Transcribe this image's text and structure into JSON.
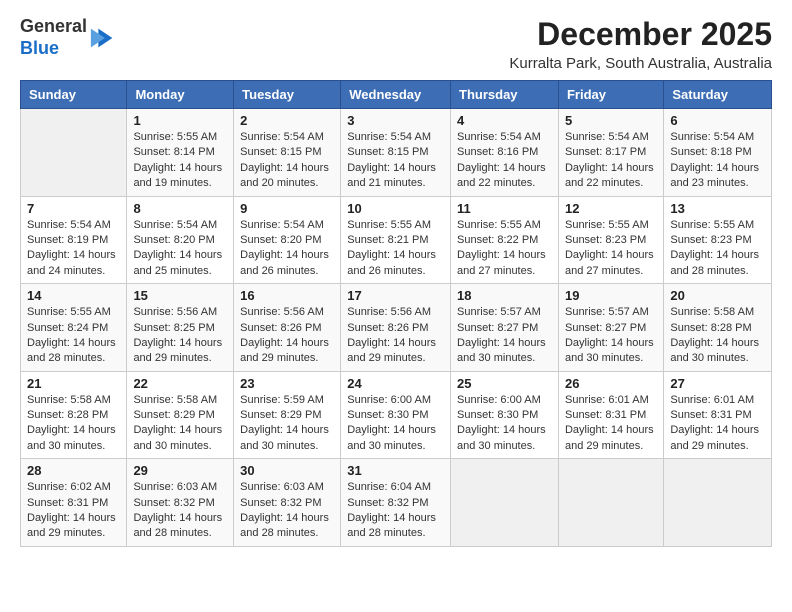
{
  "logo": {
    "general": "General",
    "blue": "Blue"
  },
  "title": {
    "month_year": "December 2025",
    "location": "Kurralta Park, South Australia, Australia"
  },
  "days_of_week": [
    "Sunday",
    "Monday",
    "Tuesday",
    "Wednesday",
    "Thursday",
    "Friday",
    "Saturday"
  ],
  "weeks": [
    [
      {
        "day": "",
        "info": ""
      },
      {
        "day": "1",
        "info": "Sunrise: 5:55 AM\nSunset: 8:14 PM\nDaylight: 14 hours\nand 19 minutes."
      },
      {
        "day": "2",
        "info": "Sunrise: 5:54 AM\nSunset: 8:15 PM\nDaylight: 14 hours\nand 20 minutes."
      },
      {
        "day": "3",
        "info": "Sunrise: 5:54 AM\nSunset: 8:15 PM\nDaylight: 14 hours\nand 21 minutes."
      },
      {
        "day": "4",
        "info": "Sunrise: 5:54 AM\nSunset: 8:16 PM\nDaylight: 14 hours\nand 22 minutes."
      },
      {
        "day": "5",
        "info": "Sunrise: 5:54 AM\nSunset: 8:17 PM\nDaylight: 14 hours\nand 22 minutes."
      },
      {
        "day": "6",
        "info": "Sunrise: 5:54 AM\nSunset: 8:18 PM\nDaylight: 14 hours\nand 23 minutes."
      }
    ],
    [
      {
        "day": "7",
        "info": "Sunrise: 5:54 AM\nSunset: 8:19 PM\nDaylight: 14 hours\nand 24 minutes."
      },
      {
        "day": "8",
        "info": "Sunrise: 5:54 AM\nSunset: 8:20 PM\nDaylight: 14 hours\nand 25 minutes."
      },
      {
        "day": "9",
        "info": "Sunrise: 5:54 AM\nSunset: 8:20 PM\nDaylight: 14 hours\nand 26 minutes."
      },
      {
        "day": "10",
        "info": "Sunrise: 5:55 AM\nSunset: 8:21 PM\nDaylight: 14 hours\nand 26 minutes."
      },
      {
        "day": "11",
        "info": "Sunrise: 5:55 AM\nSunset: 8:22 PM\nDaylight: 14 hours\nand 27 minutes."
      },
      {
        "day": "12",
        "info": "Sunrise: 5:55 AM\nSunset: 8:23 PM\nDaylight: 14 hours\nand 27 minutes."
      },
      {
        "day": "13",
        "info": "Sunrise: 5:55 AM\nSunset: 8:23 PM\nDaylight: 14 hours\nand 28 minutes."
      }
    ],
    [
      {
        "day": "14",
        "info": "Sunrise: 5:55 AM\nSunset: 8:24 PM\nDaylight: 14 hours\nand 28 minutes."
      },
      {
        "day": "15",
        "info": "Sunrise: 5:56 AM\nSunset: 8:25 PM\nDaylight: 14 hours\nand 29 minutes."
      },
      {
        "day": "16",
        "info": "Sunrise: 5:56 AM\nSunset: 8:26 PM\nDaylight: 14 hours\nand 29 minutes."
      },
      {
        "day": "17",
        "info": "Sunrise: 5:56 AM\nSunset: 8:26 PM\nDaylight: 14 hours\nand 29 minutes."
      },
      {
        "day": "18",
        "info": "Sunrise: 5:57 AM\nSunset: 8:27 PM\nDaylight: 14 hours\nand 30 minutes."
      },
      {
        "day": "19",
        "info": "Sunrise: 5:57 AM\nSunset: 8:27 PM\nDaylight: 14 hours\nand 30 minutes."
      },
      {
        "day": "20",
        "info": "Sunrise: 5:58 AM\nSunset: 8:28 PM\nDaylight: 14 hours\nand 30 minutes."
      }
    ],
    [
      {
        "day": "21",
        "info": "Sunrise: 5:58 AM\nSunset: 8:28 PM\nDaylight: 14 hours\nand 30 minutes."
      },
      {
        "day": "22",
        "info": "Sunrise: 5:58 AM\nSunset: 8:29 PM\nDaylight: 14 hours\nand 30 minutes."
      },
      {
        "day": "23",
        "info": "Sunrise: 5:59 AM\nSunset: 8:29 PM\nDaylight: 14 hours\nand 30 minutes."
      },
      {
        "day": "24",
        "info": "Sunrise: 6:00 AM\nSunset: 8:30 PM\nDaylight: 14 hours\nand 30 minutes."
      },
      {
        "day": "25",
        "info": "Sunrise: 6:00 AM\nSunset: 8:30 PM\nDaylight: 14 hours\nand 30 minutes."
      },
      {
        "day": "26",
        "info": "Sunrise: 6:01 AM\nSunset: 8:31 PM\nDaylight: 14 hours\nand 29 minutes."
      },
      {
        "day": "27",
        "info": "Sunrise: 6:01 AM\nSunset: 8:31 PM\nDaylight: 14 hours\nand 29 minutes."
      }
    ],
    [
      {
        "day": "28",
        "info": "Sunrise: 6:02 AM\nSunset: 8:31 PM\nDaylight: 14 hours\nand 29 minutes."
      },
      {
        "day": "29",
        "info": "Sunrise: 6:03 AM\nSunset: 8:32 PM\nDaylight: 14 hours\nand 28 minutes."
      },
      {
        "day": "30",
        "info": "Sunrise: 6:03 AM\nSunset: 8:32 PM\nDaylight: 14 hours\nand 28 minutes."
      },
      {
        "day": "31",
        "info": "Sunrise: 6:04 AM\nSunset: 8:32 PM\nDaylight: 14 hours\nand 28 minutes."
      },
      {
        "day": "",
        "info": ""
      },
      {
        "day": "",
        "info": ""
      },
      {
        "day": "",
        "info": ""
      }
    ]
  ]
}
